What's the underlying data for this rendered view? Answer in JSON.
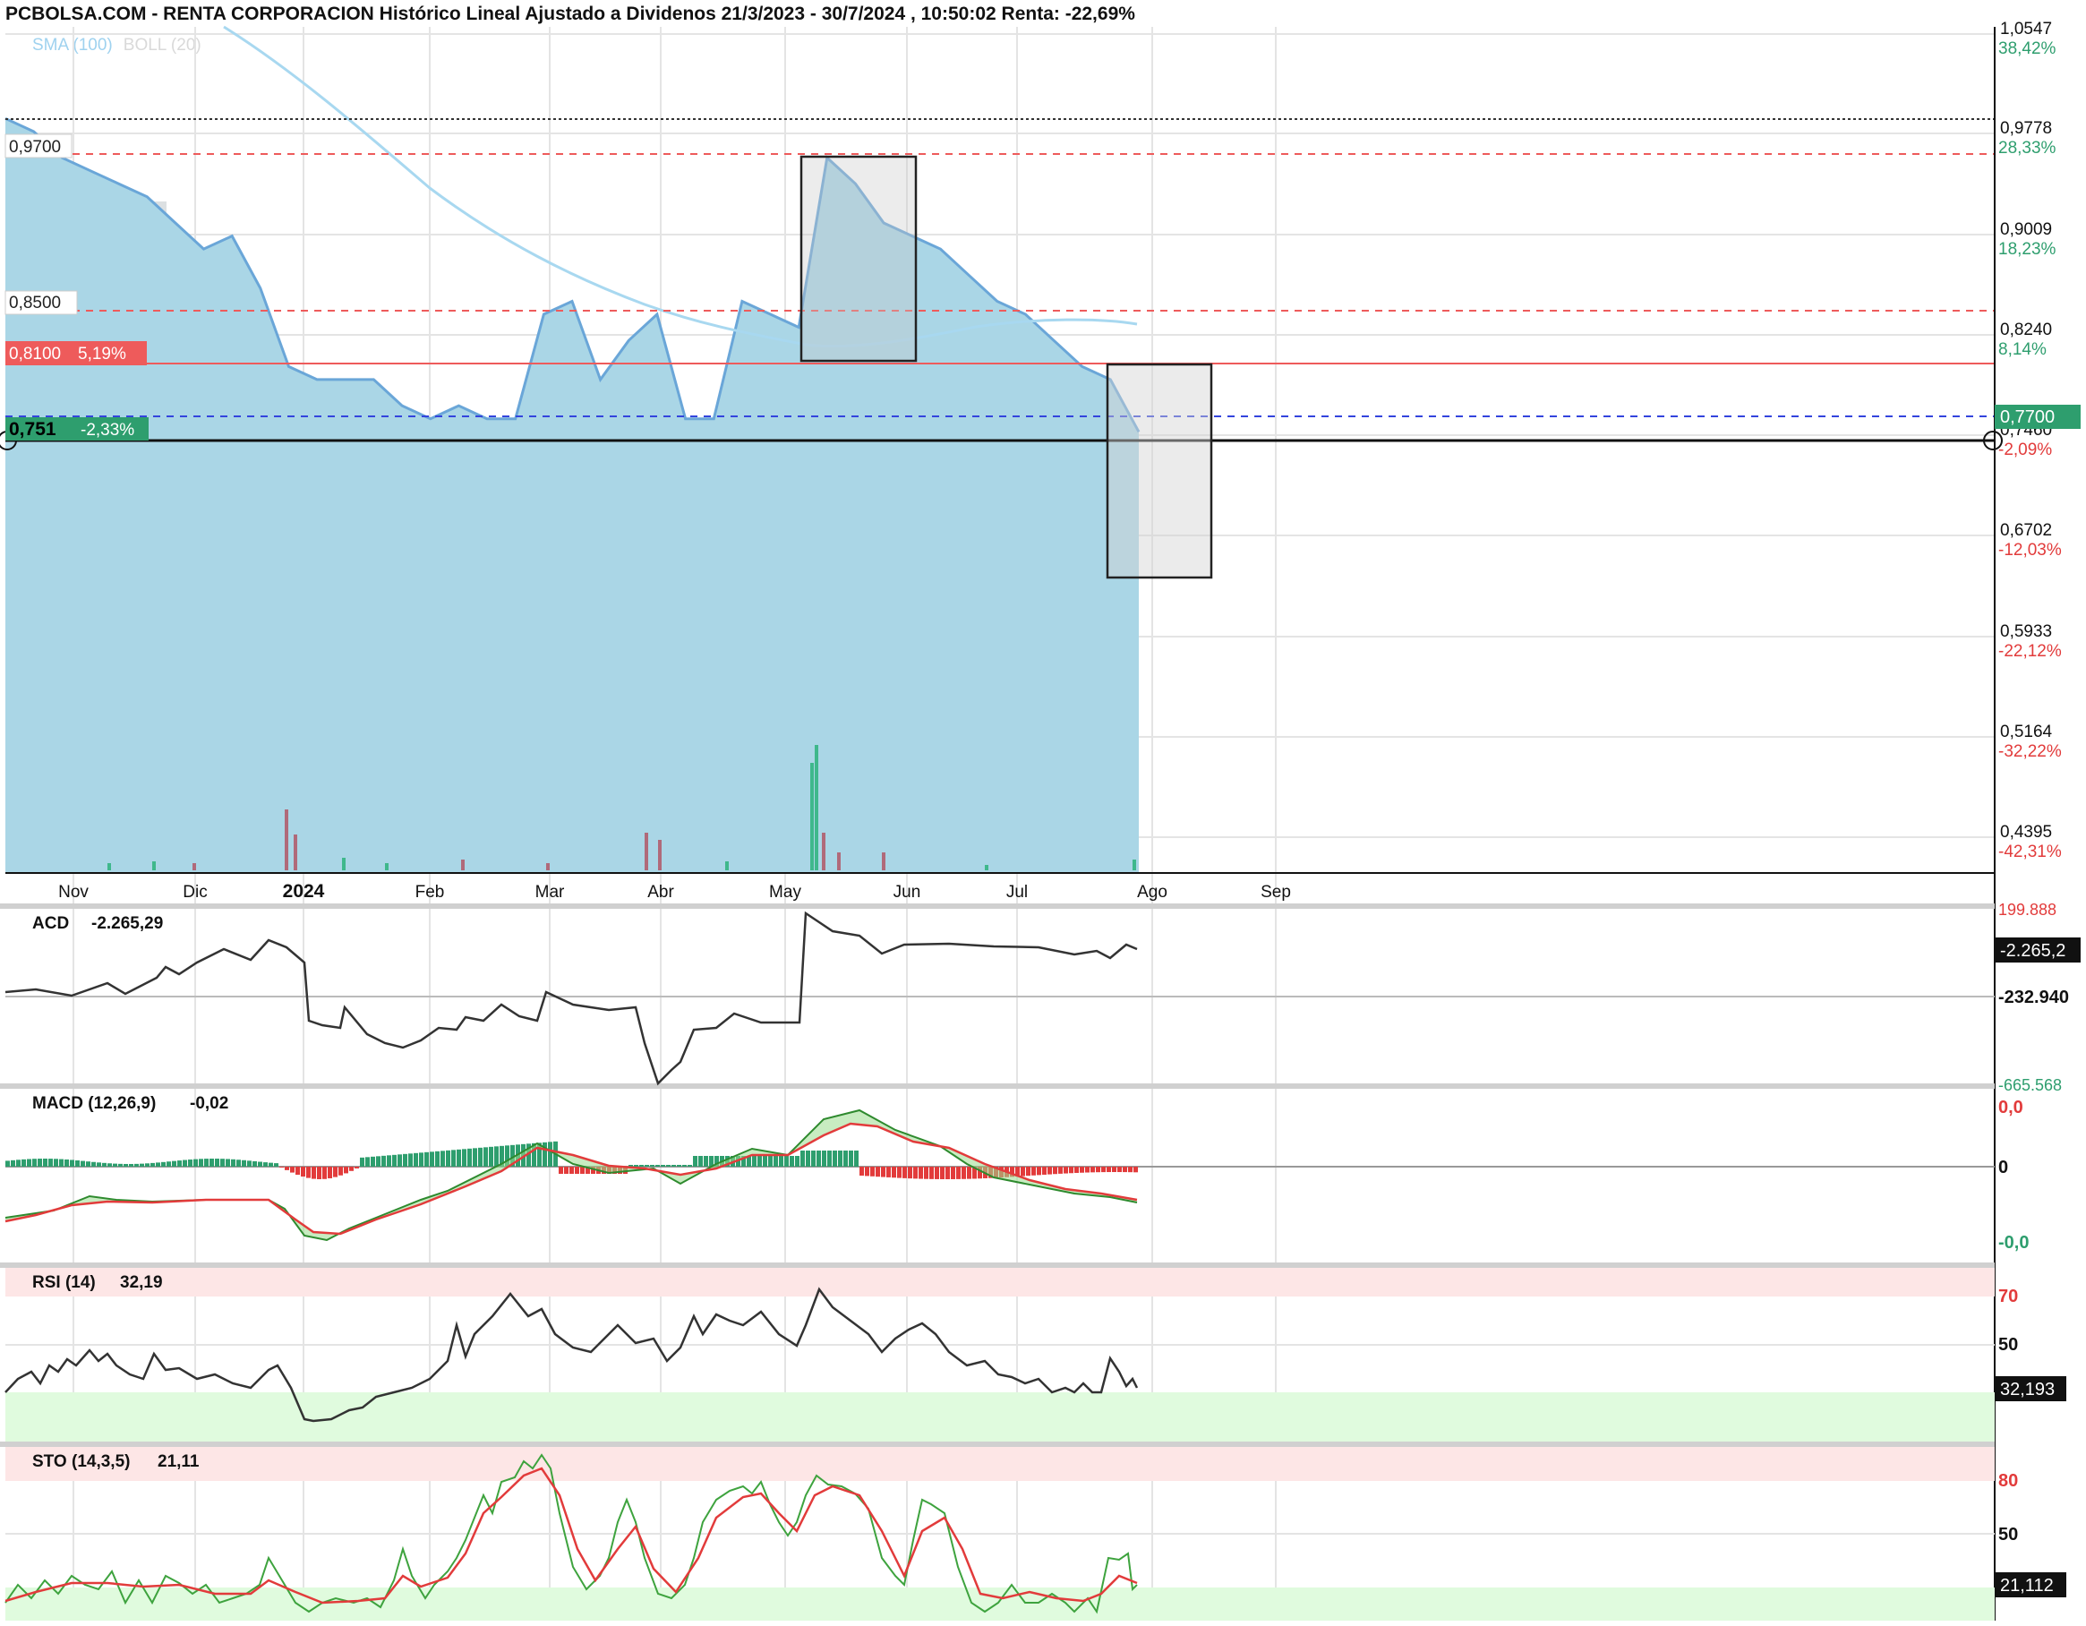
{
  "title": "PCBOLSA.COM - RENTA CORPORACION Histórico Lineal Ajustado a Dividenos 21/3/2023 - 30/7/2024 , 10:50:02 Renta: -22,69%",
  "legend": {
    "sma": "SMA (100)",
    "boll": "BOLL (20)"
  },
  "colors": {
    "area_fill": "#aad6e6",
    "area_line": "#6aa6d8",
    "sma": "#a8d8f0",
    "up": "#2e9e6e",
    "down": "#e23b3b",
    "resistance": "#ee5b5b",
    "support": "#3344dd"
  },
  "price_axis": [
    {
      "price": "1,0547",
      "pct": "38,42%",
      "dir": "up"
    },
    {
      "price": "0,9778",
      "pct": "28,33%",
      "dir": "up"
    },
    {
      "price": "0,9009",
      "pct": "18,23%",
      "dir": "up"
    },
    {
      "price": "0,8240",
      "pct": "8,14%",
      "dir": "up"
    },
    {
      "price": "0,7460",
      "pct": "-2,09%",
      "dir": "down"
    },
    {
      "price": "0,6702",
      "pct": "-12,03%",
      "dir": "down"
    },
    {
      "price": "0,5933",
      "pct": "-22,12%",
      "dir": "down"
    },
    {
      "price": "0,5164",
      "pct": "-32,22%",
      "dir": "down"
    },
    {
      "price": "0,4395",
      "pct": "-42,31%",
      "dir": "down"
    }
  ],
  "price_tags": {
    "current": "0,7700",
    "cursor": "0,751",
    "cursor_pct": "-2,33%",
    "level_097": "0,9700",
    "level_085": "0,8500",
    "level_081": "0,8100",
    "level_081_pct": "5,19%"
  },
  "months": [
    "Nov",
    "Dic",
    "2024",
    "Feb",
    "Mar",
    "Abr",
    "May",
    "Jun",
    "Jul",
    "Ago",
    "Sep"
  ],
  "acd": {
    "label": "ACD",
    "value": "-2.265,29",
    "tag": "-2.265,2",
    "mid": "-232.940",
    "top_cut": "199.888",
    "bottom_cut": "-665.568"
  },
  "macd": {
    "label": "MACD (12,26,9)",
    "value": "-0,02",
    "top": "0,0",
    "zero": "0",
    "bottom": "-0,0"
  },
  "rsi": {
    "label": "RSI (14)",
    "value": "32,19",
    "tag": "32,193",
    "levels": [
      "70",
      "50"
    ]
  },
  "sto": {
    "label": "STO (14,3,5)",
    "value": "21,11",
    "tag": "21,112",
    "levels": [
      "80",
      "50"
    ]
  },
  "chart_data": [
    {
      "type": "area",
      "title": "RENTA CORPORACION",
      "x": [
        "2023-10-23",
        "2023-10-30",
        "2023-11-06",
        "2023-11-13",
        "2023-11-20",
        "2023-11-27",
        "2023-12-04",
        "2023-12-11",
        "2023-12-18",
        "2023-12-25",
        "2024-01-01",
        "2024-01-08",
        "2024-01-15",
        "2024-01-22",
        "2024-01-29",
        "2024-02-05",
        "2024-02-12",
        "2024-02-19",
        "2024-02-26",
        "2024-03-04",
        "2024-03-11",
        "2024-03-18",
        "2024-03-25",
        "2024-04-01",
        "2024-04-08",
        "2024-04-15",
        "2024-04-22",
        "2024-04-29",
        "2024-05-06",
        "2024-05-13",
        "2024-05-20",
        "2024-05-27",
        "2024-06-03",
        "2024-06-10",
        "2024-06-17",
        "2024-06-24",
        "2024-07-01",
        "2024-07-08",
        "2024-07-15",
        "2024-07-22",
        "2024-07-29"
      ],
      "series": [
        {
          "values": [
            0.99,
            0.98,
            0.96,
            0.95,
            0.94,
            0.93,
            0.91,
            0.89,
            0.9,
            0.86,
            0.8,
            0.79,
            0.79,
            0.79,
            0.77,
            0.76,
            0.77,
            0.76,
            0.76,
            0.84,
            0.85,
            0.79,
            0.82,
            0.84,
            0.76,
            0.76,
            0.85,
            0.84,
            0.83,
            0.96,
            0.94,
            0.91,
            0.9,
            0.89,
            0.87,
            0.85,
            0.84,
            0.82,
            0.8,
            0.79,
            0.75
          ]
        }
      ],
      "ylim": [
        0.4395,
        1.0547
      ],
      "support_lines": [
        0.97,
        0.85,
        0.81,
        0.77,
        0.751
      ]
    }
  ]
}
